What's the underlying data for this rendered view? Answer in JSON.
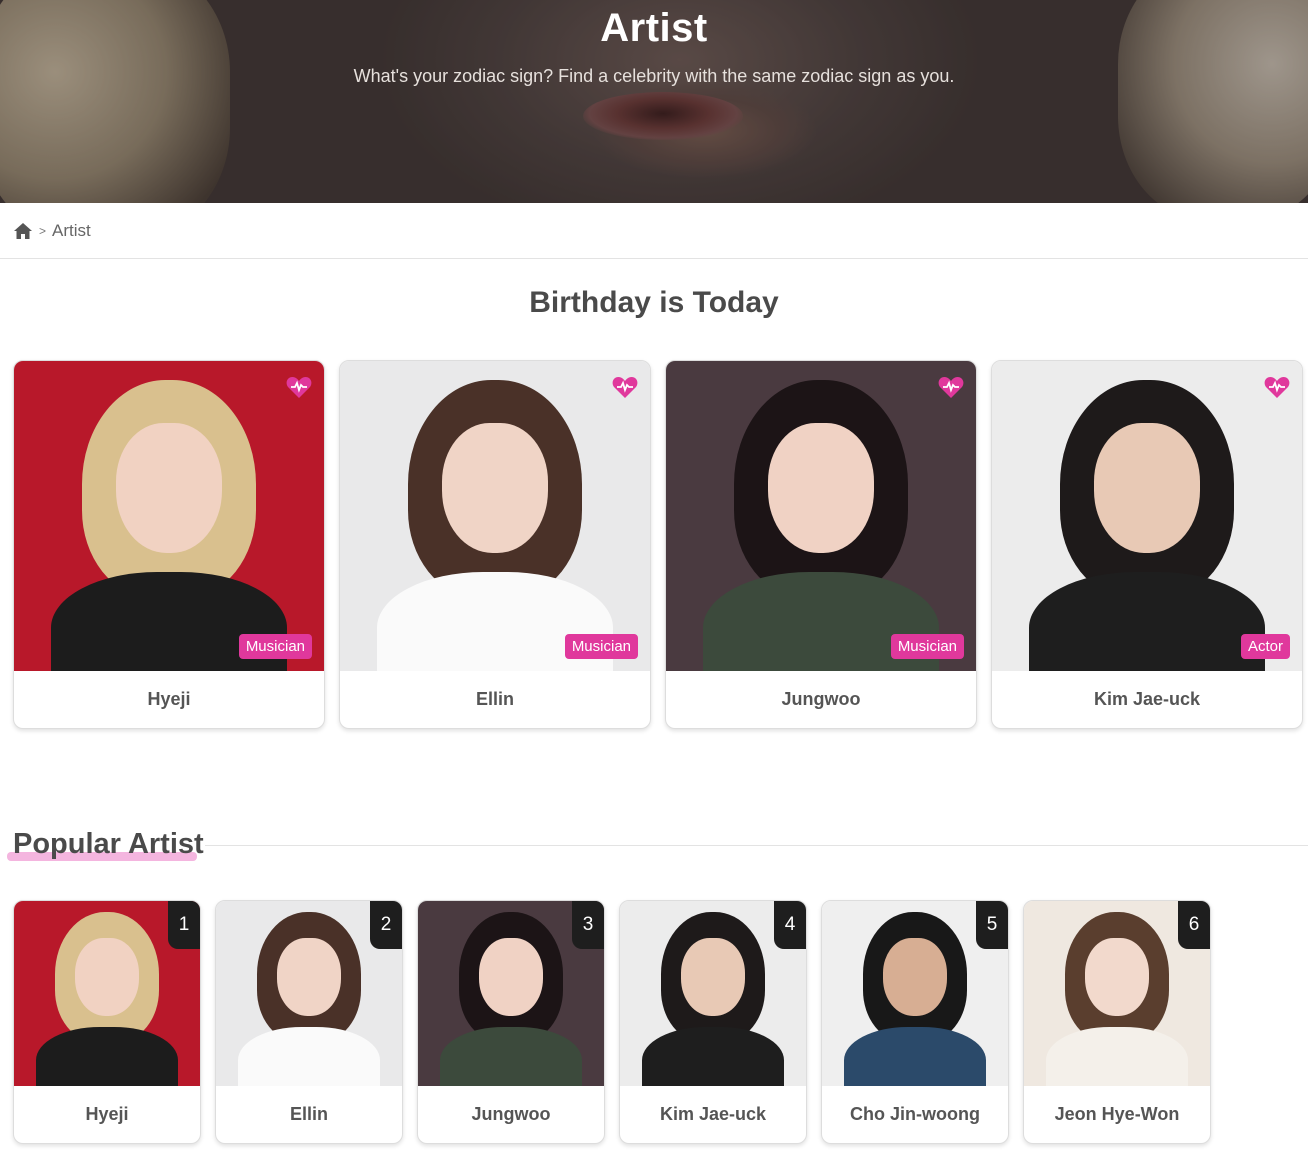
{
  "hero": {
    "title": "Artist",
    "subtitle": "What's your zodiac sign? Find a celebrity with the same zodiac sign as you."
  },
  "breadcrumb": {
    "home_icon": "home-icon",
    "separator": ">",
    "current": "Artist"
  },
  "birthday": {
    "title": "Birthday is Today",
    "cards": [
      {
        "name": "Hyeji",
        "category": "Musician",
        "bg": "#b8182a",
        "hair": "#d9c08e",
        "skin": "#f1d2c2",
        "top": "#1c1c1c"
      },
      {
        "name": "Ellin",
        "category": "Musician",
        "bg": "#e9e9ea",
        "hair": "#4a3128",
        "skin": "#f0d4c6",
        "top": "#fafafa"
      },
      {
        "name": "Jungwoo",
        "category": "Musician",
        "bg": "#4a3a40",
        "hair": "#1c1416",
        "skin": "#f0d2c4",
        "top": "#3c4a3c"
      },
      {
        "name": "Kim Jae-uck",
        "category": "Actor",
        "bg": "#ececec",
        "hair": "#1e1a1a",
        "skin": "#e8c9b5",
        "top": "#1e1e1e"
      }
    ]
  },
  "popular": {
    "title": "Popular Artist",
    "cards": [
      {
        "rank": "1",
        "name": "Hyeji",
        "bg": "#b8182a",
        "hair": "#d9c08e",
        "skin": "#f1d2c2",
        "top": "#1c1c1c"
      },
      {
        "rank": "2",
        "name": "Ellin",
        "bg": "#e9e9ea",
        "hair": "#4a3128",
        "skin": "#f0d4c6",
        "top": "#fafafa"
      },
      {
        "rank": "3",
        "name": "Jungwoo",
        "bg": "#4a3a40",
        "hair": "#1c1416",
        "skin": "#f0d2c4",
        "top": "#3c4a3c"
      },
      {
        "rank": "4",
        "name": "Kim Jae-uck",
        "bg": "#ececec",
        "hair": "#1e1a1a",
        "skin": "#e8c9b5",
        "top": "#1e1e1e"
      },
      {
        "rank": "5",
        "name": "Cho Jin-woong",
        "bg": "#efefef",
        "hair": "#181818",
        "skin": "#d7ae93",
        "top": "#2b4a6a"
      },
      {
        "rank": "6",
        "name": "Jeon Hye-Won",
        "bg": "#efe8e0",
        "hair": "#5a3e2e",
        "skin": "#f2d9cc",
        "top": "#f4f0ea"
      }
    ]
  },
  "colors": {
    "accent": "#e0389c",
    "rank_bg": "#1e1e1e"
  }
}
